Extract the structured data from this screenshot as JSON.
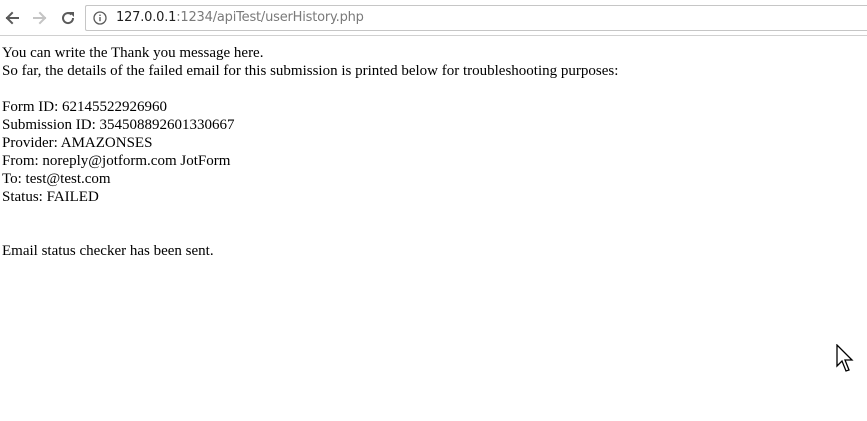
{
  "browser": {
    "url_host": "127.0.0.1",
    "url_rest": ":1234/apiTest/userHistory.php",
    "icons": {
      "back": "back-arrow-icon",
      "forward": "forward-arrow-icon",
      "reload": "reload-icon",
      "info": "info-icon"
    }
  },
  "page": {
    "intro_line1": "You can write the Thank you message here.",
    "intro_line2": "So far, the details of the failed email for this submission is printed below for troubleshooting purposes:",
    "details": [
      "Form ID: 62145522926960",
      "Submission ID: 354508892601330667",
      "Provider: AMAZONSES",
      "From: noreply@jotform.com JotForm",
      "To: test@test.com",
      "Status: FAILED"
    ],
    "footer": "Email status checker has been sent."
  },
  "colors": {
    "text": "#000000",
    "url_host": "#202020",
    "url_rest": "#7a7a7a",
    "toolbar_border": "#d0d0d0"
  }
}
